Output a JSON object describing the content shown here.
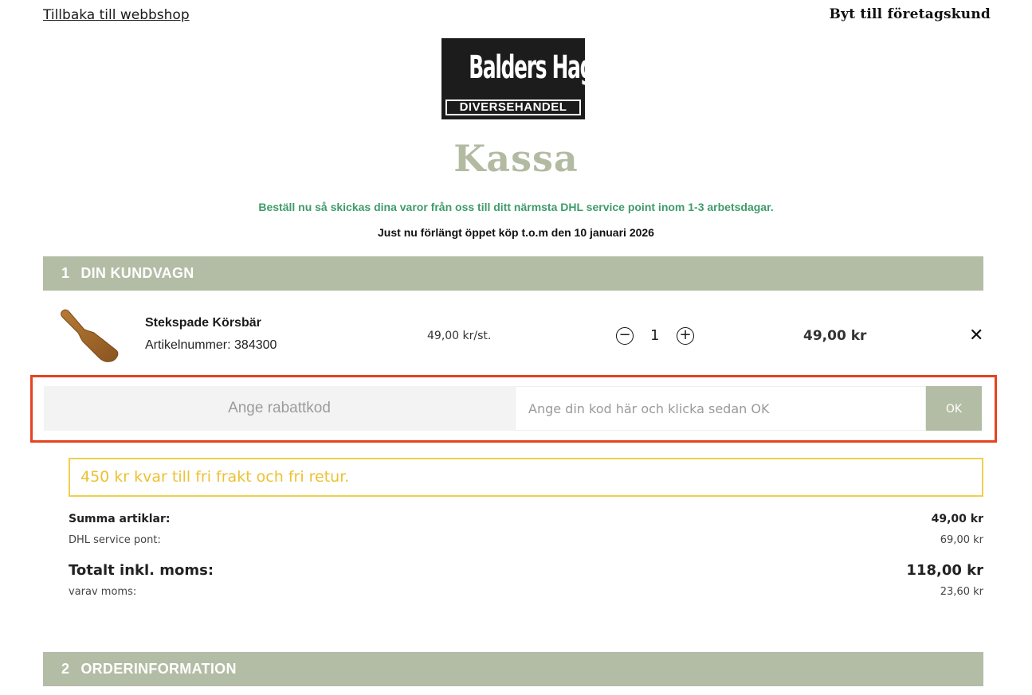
{
  "header": {
    "back_link": "Tillbaka till webbshop",
    "business_link": "Byt till företagskund"
  },
  "logo": {
    "top": "Balders Hage",
    "bottom": "DIVERSEHANDEL"
  },
  "page_title": "Kassa",
  "notices": {
    "shipping": "Beställ nu så skickas dina varor från oss till ditt närmsta DHL service point inom 1-3 arbetsdagar.",
    "returns": "Just nu förlängt öppet köp t.o.m den 10 januari 2026"
  },
  "sections": [
    {
      "number": "1",
      "label": "DIN KUNDVAGN"
    },
    {
      "number": "2",
      "label": "ORDERINFORMATION"
    }
  ],
  "cart": {
    "items": [
      {
        "name": "Stekspade Körsbär",
        "sku": "Artikelnummer: 384300",
        "unit_price": "49,00 kr/st.",
        "quantity": "1",
        "total": "49,00 kr",
        "minus_symbol": "−",
        "plus_symbol": "+",
        "remove_symbol": "✕"
      }
    ]
  },
  "discount": {
    "label": "Ange rabattkod",
    "placeholder": "Ange din kod här och klicka sedan OK",
    "value": "",
    "button": "OK"
  },
  "free_shipping": "450 kr kvar till fri frakt och fri retur.",
  "summary": {
    "items_label": "Summa artiklar:",
    "items_value": "49,00 kr",
    "shipping_label": "DHL service pont:",
    "shipping_value": "69,00 kr",
    "total_label": "Totalt inkl. moms:",
    "total_value": "118,00 kr",
    "vat_label": "varav moms:",
    "vat_value": "23,60 kr"
  },
  "colors": {
    "accent": "#b3bca5",
    "notice_green": "#3e9b6a",
    "highlight": "#e5431f",
    "free_shipping": "#ecc132"
  }
}
